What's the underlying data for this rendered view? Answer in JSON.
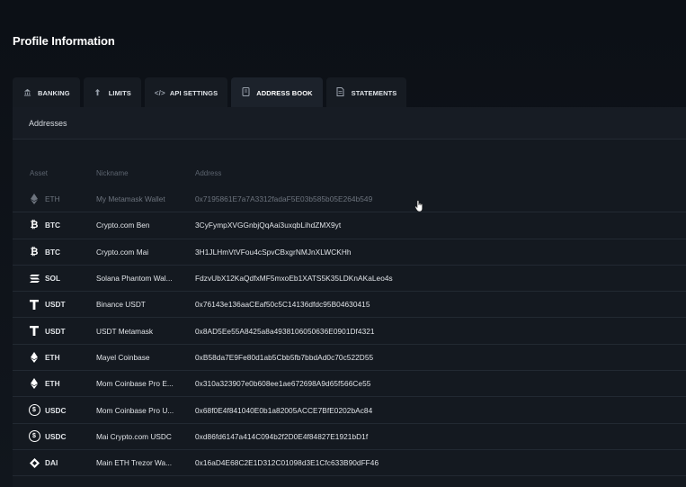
{
  "page": {
    "title": "Profile Information"
  },
  "tabs": [
    {
      "label": "BANKING",
      "icon": "bank-icon"
    },
    {
      "label": "LIMITS",
      "icon": "limits-icon"
    },
    {
      "label": "API SETTINGS",
      "icon": "code-icon"
    },
    {
      "label": "ADDRESS BOOK",
      "icon": "book-icon",
      "active": true
    },
    {
      "label": "STATEMENTS",
      "icon": "statement-icon"
    }
  ],
  "panel": {
    "title": "Addresses",
    "columns": {
      "asset": "Asset",
      "nickname": "Nickname",
      "address": "Address"
    }
  },
  "rows": [
    {
      "asset": "ETH",
      "icon": "eth-icon",
      "nickname": "My Metamask Wallet",
      "address": "0x7195861E7a7A3312fadaF5E03b585b05E264b549",
      "dim": true
    },
    {
      "asset": "BTC",
      "icon": "btc-icon",
      "nickname": "Crypto.com Ben",
      "address": "3CyFympXVGGnbjQqAai3uxqbLihdZMX9yt"
    },
    {
      "asset": "BTC",
      "icon": "btc-icon",
      "nickname": "Crypto.com Mai",
      "address": "3H1JLHmVtVFou4cSpvCBxgrNMJnXLWCKHh"
    },
    {
      "asset": "SOL",
      "icon": "sol-icon",
      "nickname": "Solana Phantom Wal...",
      "address": "FdzvUbX12KaQdfxMF5mxoEb1XATS5K35LDKnAKaLeo4s"
    },
    {
      "asset": "USDT",
      "icon": "usdt-icon",
      "nickname": "Binance USDT",
      "address": "0x76143e136aaCEaf50c5C14136dfdc95B04630415"
    },
    {
      "asset": "USDT",
      "icon": "usdt-icon",
      "nickname": "USDT Metamask",
      "address": "0x8AD5Ee55A8425a8a4938106050636E0901Df4321"
    },
    {
      "asset": "ETH",
      "icon": "eth-icon",
      "nickname": "Mayel Coinbase",
      "address": "0xB58da7E9Fe80d1ab5Cbb5fb7bbdAd0c70c522D55"
    },
    {
      "asset": "ETH",
      "icon": "eth-icon",
      "nickname": "Mom Coinbase Pro E...",
      "address": "0x310a323907e0b608ee1ae672698A9d65f566Ce55"
    },
    {
      "asset": "USDC",
      "icon": "usdc-icon",
      "nickname": "Mom Coinbase Pro U...",
      "address": "0x68f0E4f841040E0b1a82005ACCE7BfE0202bAc84"
    },
    {
      "asset": "USDC",
      "icon": "usdc-icon",
      "nickname": "Mai Crypto.com USDC",
      "address": "0xd86fd6147a414C094b2f2D0E4f84827E1921bD1f"
    },
    {
      "asset": "DAI",
      "icon": "dai-icon",
      "nickname": "Main ETH Trezor Wa...",
      "address": "0x16aD4E68C2E1D312C01098d3E1Cfc633B90dFF46"
    }
  ]
}
